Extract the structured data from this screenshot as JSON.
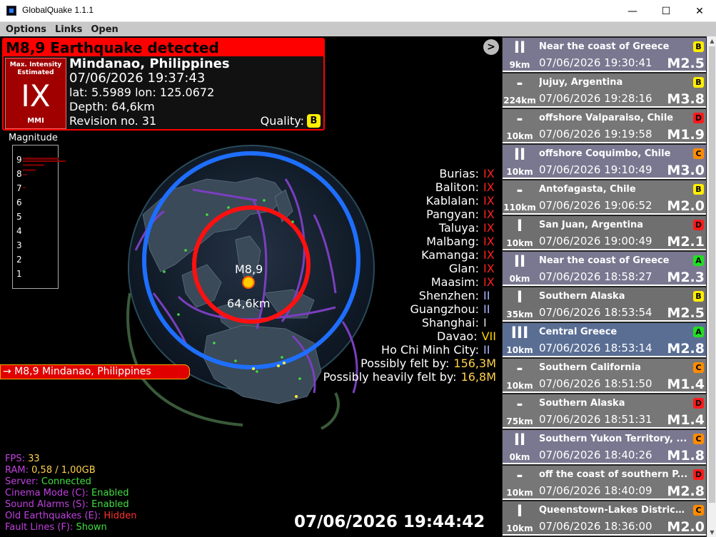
{
  "window": {
    "title": "GlobalQuake 1.1.1",
    "minimize": "—",
    "maximize": "☐",
    "close": "✕"
  },
  "menu": [
    "Options",
    "Links",
    "Open"
  ],
  "alert": {
    "header": "M8,9 Earthquake detected",
    "intensity_label_1": "Max. Intensity",
    "intensity_label_2": "Estimated",
    "intensity": "IX",
    "scale": "MMI",
    "location": "Mindanao, Philippines",
    "time": "07/06/2026 19:37:43",
    "coords": "lat: 5.5989 lon: 125.0672",
    "depth": "Depth: 64,6km",
    "revision": "Revision no. 31",
    "quality_label": "Quality:",
    "quality": "B"
  },
  "magnitude_panel": {
    "title": "Magnitude",
    "ticks": [
      "9",
      "8",
      "7",
      "6",
      "5",
      "4",
      "3",
      "2",
      "1"
    ]
  },
  "map_labels": {
    "magnitude": "M8,9",
    "depth": "64,6km"
  },
  "cities": [
    {
      "name": "Burias:",
      "value": "IX",
      "color": "#ff2020"
    },
    {
      "name": "Baliton:",
      "value": "IX",
      "color": "#ff2020"
    },
    {
      "name": "Kablalan:",
      "value": "IX",
      "color": "#ff2020"
    },
    {
      "name": "Pangyan:",
      "value": "IX",
      "color": "#ff2020"
    },
    {
      "name": "Taluya:",
      "value": "IX",
      "color": "#ff2020"
    },
    {
      "name": "Malbang:",
      "value": "IX",
      "color": "#ff2020"
    },
    {
      "name": "Kamanga:",
      "value": "IX",
      "color": "#ff2020"
    },
    {
      "name": "Glan:",
      "value": "IX",
      "color": "#ff2020"
    },
    {
      "name": "Maasim:",
      "value": "IX",
      "color": "#ff2020"
    },
    {
      "name": "Shenzhen:",
      "value": "II",
      "color": "#aab4ff"
    },
    {
      "name": "Guangzhou:",
      "value": "II",
      "color": "#aab4ff"
    },
    {
      "name": "Shanghai:",
      "value": "I",
      "color": "#dddddd"
    },
    {
      "name": "Davao:",
      "value": "VII",
      "color": "#ffd000"
    },
    {
      "name": "Ho Chi Minh City:",
      "value": "II",
      "color": "#aab4ff"
    }
  ],
  "felt": [
    {
      "label": "Possibly felt by:",
      "value": "156,3M"
    },
    {
      "label": "Possibly heavily felt by:",
      "value": "16,8M"
    }
  ],
  "quake_tag": "→ M8,9 Mindanao, Philippines",
  "next_button": ">",
  "status": [
    {
      "label": "FPS: ",
      "value": "33",
      "color": "#ffd24a"
    },
    {
      "label": "RAM: ",
      "value": "0,58 / 1,00GB",
      "color": "#ffd24a"
    },
    {
      "label": "Server: ",
      "value": "Connected",
      "color": "#40e040"
    },
    {
      "label": "Cinema Mode (C): ",
      "value": "Enabled",
      "color": "#40e040"
    },
    {
      "label": "Sound Alarms (S): ",
      "value": "Enabled",
      "color": "#40e040"
    },
    {
      "label": "Old Earthquakes (E): ",
      "value": "Hidden",
      "color": "#ff3030"
    },
    {
      "label": "Fault Lines (F): ",
      "value": "Shown",
      "color": "#40e040"
    }
  ],
  "clock": "07/06/2026 19:44:42",
  "earthquakes": [
    {
      "intensity": "II",
      "depth": "9km",
      "region": "Near the coast of Greece",
      "time": "07/06/2026 19:30:41",
      "mag": "M2.5",
      "quality": "B",
      "qcolor": "#ffee00",
      "bg": "#7a7890"
    },
    {
      "intensity": "-",
      "depth": "224km",
      "region": "Jujuy, Argentina",
      "time": "07/06/2026 19:28:16",
      "mag": "M3.8",
      "quality": "B",
      "qcolor": "#ffee00",
      "bg": "#777777"
    },
    {
      "intensity": "-",
      "depth": "10km",
      "region": "offshore Valparaiso, Chile",
      "time": "07/06/2026 19:19:58",
      "mag": "M1.9",
      "quality": "D",
      "qcolor": "#ff1a1a",
      "bg": "#777777"
    },
    {
      "intensity": "II",
      "depth": "10km",
      "region": "offshore Coquimbo, Chile",
      "time": "07/06/2026 19:10:49",
      "mag": "M3.0",
      "quality": "C",
      "qcolor": "#ff8c00",
      "bg": "#7a7890"
    },
    {
      "intensity": "-",
      "depth": "110km",
      "region": "Antofagasta, Chile",
      "time": "07/06/2026 19:06:52",
      "mag": "M2.0",
      "quality": "B",
      "qcolor": "#ffee00",
      "bg": "#777777"
    },
    {
      "intensity": "I",
      "depth": "10km",
      "region": "San Juan, Argentina",
      "time": "07/06/2026 19:00:49",
      "mag": "M2.1",
      "quality": "D",
      "qcolor": "#ff1a1a",
      "bg": "#6f6f6f"
    },
    {
      "intensity": "II",
      "depth": "0km",
      "region": "Near the coast of Greece",
      "time": "07/06/2026 18:58:27",
      "mag": "M2.3",
      "quality": "A",
      "qcolor": "#20e020",
      "bg": "#7a7890"
    },
    {
      "intensity": "I",
      "depth": "35km",
      "region": "Southern Alaska",
      "time": "07/06/2026 18:53:54",
      "mag": "M2.5",
      "quality": "B",
      "qcolor": "#ffee00",
      "bg": "#6f6f6f"
    },
    {
      "intensity": "III",
      "depth": "10km",
      "region": "Central Greece",
      "time": "07/06/2026 18:53:14",
      "mag": "M2.8",
      "quality": "A",
      "qcolor": "#20e020",
      "bg": "#5a6e94"
    },
    {
      "intensity": "-",
      "depth": "10km",
      "region": "Southern California",
      "time": "07/06/2026 18:51:50",
      "mag": "M1.4",
      "quality": "C",
      "qcolor": "#ff8c00",
      "bg": "#777777"
    },
    {
      "intensity": "-",
      "depth": "75km",
      "region": "Southern Alaska",
      "time": "07/06/2026 18:51:31",
      "mag": "M1.4",
      "quality": "D",
      "qcolor": "#ff1a1a",
      "bg": "#777777"
    },
    {
      "intensity": "II",
      "depth": "0km",
      "region": "Southern Yukon Territory, ...",
      "time": "07/06/2026 18:40:26",
      "mag": "M1.8",
      "quality": "C",
      "qcolor": "#ff8c00",
      "bg": "#7a7890"
    },
    {
      "intensity": "-",
      "depth": "10km",
      "region": "off the coast of southern P...",
      "time": "07/06/2026 18:40:09",
      "mag": "M2.8",
      "quality": "D",
      "qcolor": "#ff1a1a",
      "bg": "#777777"
    },
    {
      "intensity": "I",
      "depth": "10km",
      "region": "Queenstown-Lakes District...",
      "time": "07/06/2026 18:36:00",
      "mag": "M2.0",
      "quality": "C",
      "qcolor": "#ff8c00",
      "bg": "#6f6f6f"
    }
  ]
}
